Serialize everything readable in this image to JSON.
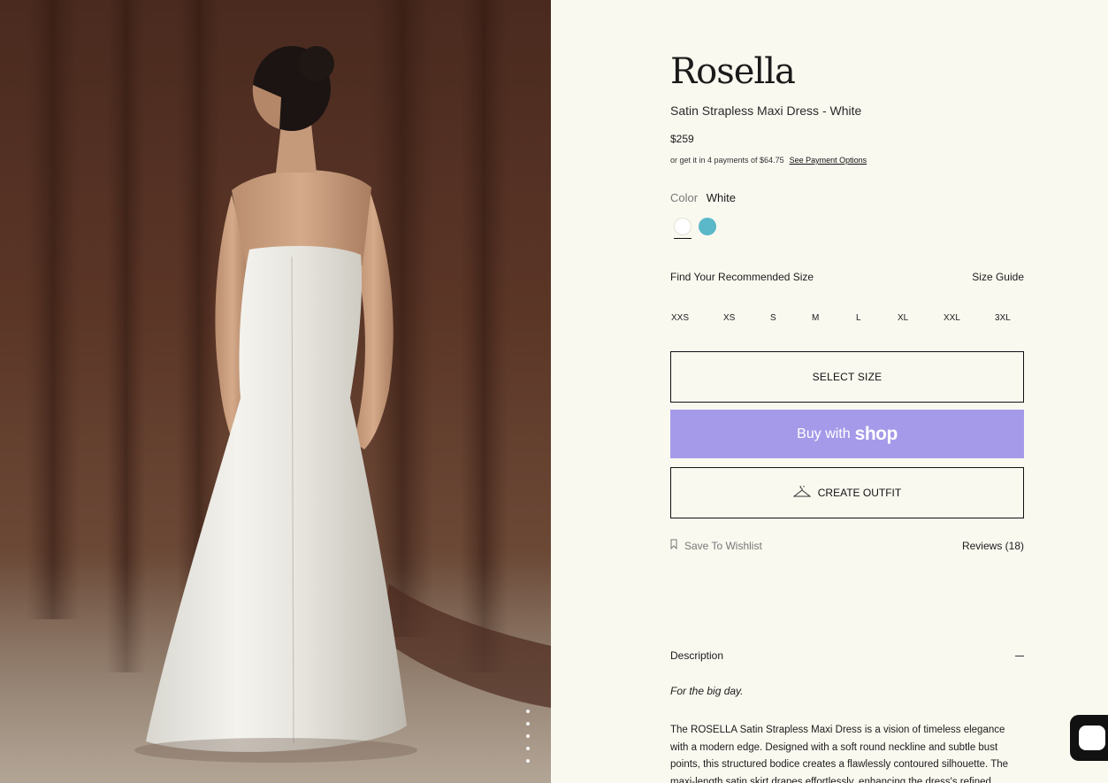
{
  "image": {
    "alt": "Model wearing a white satin strapless maxi dress in front of a brown curtain"
  },
  "product": {
    "brand": "Rosella",
    "subtitle": "Satin Strapless Maxi Dress - White",
    "price": "$259",
    "installments_text": "or get it in 4 payments of $64.75",
    "installments_link": "See Payment Options"
  },
  "color": {
    "label": "Color",
    "selected": "White",
    "swatches": [
      {
        "name": "White",
        "hex": "#ffffff"
      },
      {
        "name": "Blue",
        "hex": "#5ab8c8"
      }
    ]
  },
  "size": {
    "find_label": "Find Your Recommended Size",
    "guide_label": "Size Guide",
    "options": [
      "XXS",
      "XS",
      "S",
      "M",
      "L",
      "XL",
      "XXL",
      "3XL"
    ]
  },
  "actions": {
    "select_size": "SELECT SIZE",
    "buy_with": "Buy with",
    "shop_word": "shop",
    "create_outfit": "CREATE OUTFIT",
    "wishlist": "Save To Wishlist",
    "reviews": "Reviews (18)"
  },
  "description": {
    "heading": "Description",
    "tagline": "For the big day.",
    "body": "The ROSELLA Satin Strapless Maxi Dress is a vision of timeless elegance with a modern edge. Designed with a soft round neckline and subtle bust points, this structured bodice creates a flawlessly contoured silhouette. The maxi-length satin skirt drapes effortlessly, enhancing the dress's refined fluidity. An internal waist stay"
  },
  "colors": {
    "background": "#faf9f0",
    "shop_purple": "#a59ae9",
    "curtain": "#5b3627"
  },
  "gallery": {
    "dots": 5
  }
}
